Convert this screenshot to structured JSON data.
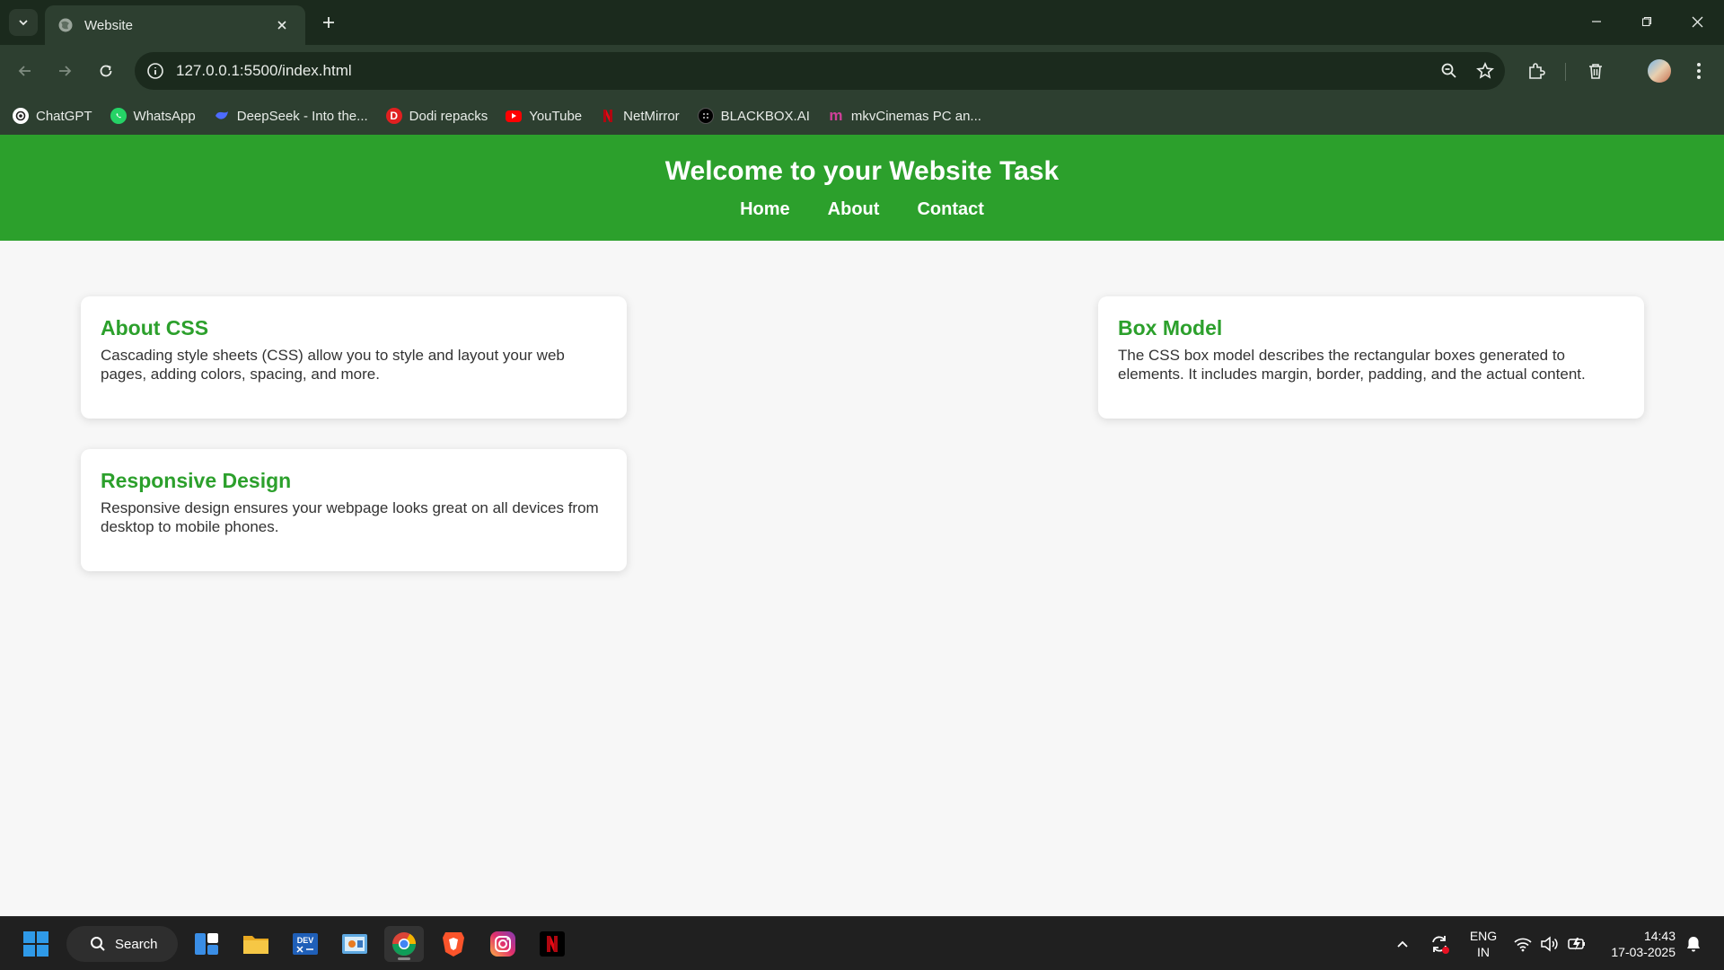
{
  "browser": {
    "tab_title": "Website",
    "url": "127.0.0.1:5500/index.html",
    "bookmarks": [
      {
        "label": "ChatGPT",
        "color": "#ffffff"
      },
      {
        "label": "WhatsApp",
        "color": "#25d366"
      },
      {
        "label": "DeepSeek - Into the...",
        "color": "#4d6bfe"
      },
      {
        "label": "Dodi repacks",
        "color": "#e02020"
      },
      {
        "label": "YouTube",
        "color": "#ff0000"
      },
      {
        "label": "NetMirror",
        "color": "#e50914"
      },
      {
        "label": "BLACKBOX.AI",
        "color": "#000000"
      },
      {
        "label": "mkvCinemas PC an...",
        "color": "#c0309a"
      }
    ]
  },
  "site": {
    "title": "Welcome to your Website Task",
    "nav": [
      "Home",
      "About",
      "Contact"
    ],
    "accent": "#2ca02c",
    "cards": [
      {
        "heading": "About CSS",
        "body": "Cascading style sheets (CSS) allow you to style and layout your web pages, adding colors, spacing, and more."
      },
      {
        "heading": "Box Model",
        "body": "The CSS box model describes the rectangular boxes generated to elements. It includes margin, border, padding, and the actual content."
      },
      {
        "heading": "Responsive Design",
        "body": "Responsive design ensures your webpage looks great on all devices from desktop to mobile phones."
      }
    ]
  },
  "taskbar": {
    "search_label": "Search",
    "apps": [
      "widgets-icon",
      "file-explorer-icon",
      "dev-icon",
      "control-panel-icon",
      "chrome-icon",
      "brave-icon",
      "instagram-icon",
      "netflix-icon"
    ],
    "lang_line1": "ENG",
    "lang_line2": "IN",
    "time": "14:43",
    "date": "17-03-2025"
  }
}
